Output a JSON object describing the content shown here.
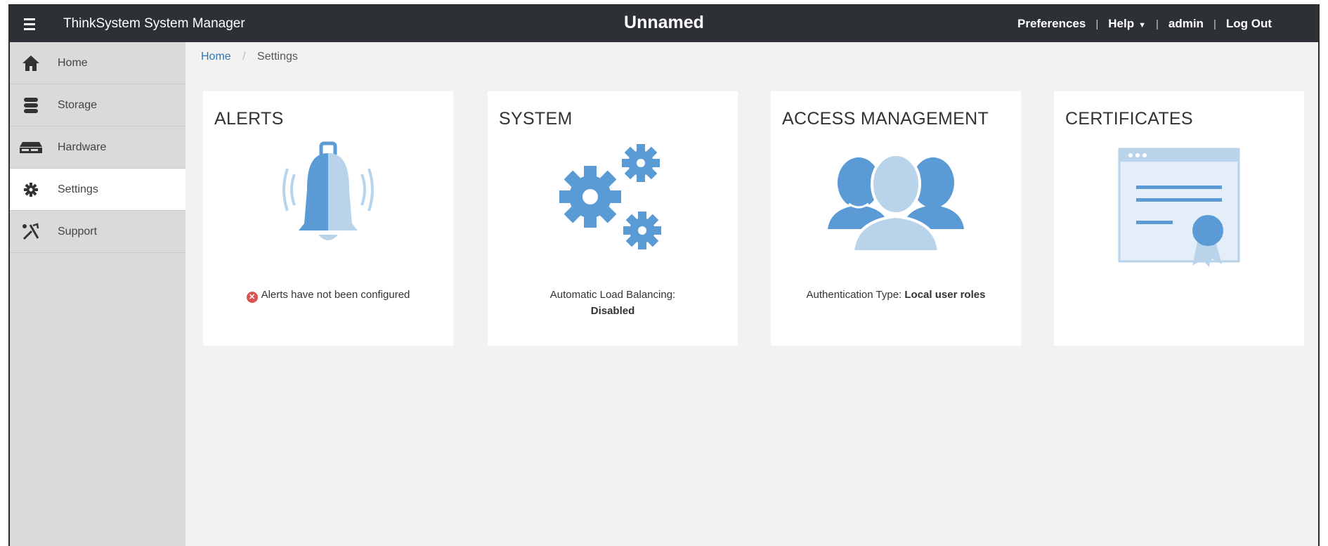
{
  "header": {
    "menu_icon": "hamburger-icon",
    "app_title": "ThinkSystem System Manager",
    "system_name": "Unnamed",
    "links": {
      "preferences": "Preferences",
      "help": "Help",
      "user": "admin",
      "logout": "Log Out"
    }
  },
  "sidebar": {
    "items": [
      {
        "label": "Home",
        "icon": "home-icon"
      },
      {
        "label": "Storage",
        "icon": "storage-icon"
      },
      {
        "label": "Hardware",
        "icon": "hardware-icon"
      },
      {
        "label": "Settings",
        "icon": "gear-icon",
        "active": true
      },
      {
        "label": "Support",
        "icon": "tools-icon"
      }
    ]
  },
  "breadcrumb": {
    "home": "Home",
    "current": "Settings"
  },
  "tiles": {
    "alerts": {
      "title": "ALERTS",
      "icon": "bell-icon",
      "message": "Alerts have not been configured",
      "status_icon": "error-icon"
    },
    "system": {
      "title": "SYSTEM",
      "icon": "gears-icon",
      "label": "Automatic Load Balancing:",
      "value": "Disabled"
    },
    "access": {
      "title": "ACCESS MANAGEMENT",
      "icon": "users-icon",
      "label": "Authentication Type:",
      "value": "Local user roles"
    },
    "certificates": {
      "title": "CERTIFICATES",
      "icon": "certificate-icon"
    }
  },
  "colors": {
    "topbar": "#2d3035",
    "sidebar": "#dadada",
    "background": "#f2f2f2",
    "icon_blue": "#5b9bd5",
    "icon_light": "#b9d3ea",
    "link": "#2f74b5",
    "error": "#d9534f"
  }
}
